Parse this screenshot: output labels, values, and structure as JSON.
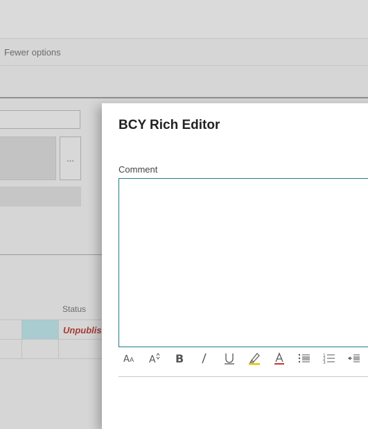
{
  "background": {
    "fewer_options": "Fewer options",
    "ellipsis": "...",
    "status_header": "Status",
    "status_value": "Unpublis"
  },
  "dialog": {
    "title": "BCY Rich Editor",
    "comment_label": "Comment",
    "toolbar": [
      "font-size-icon",
      "font-increase-icon",
      "bold-icon",
      "italic-icon",
      "underline-icon",
      "highlight-icon",
      "font-color-icon",
      "bullet-list-icon",
      "numbered-list-icon",
      "outdent-icon"
    ]
  },
  "colors": {
    "accent": "#1e7c8c",
    "status": "#a63a35",
    "highlight": "#e8c200",
    "font_color": "#c0392b"
  }
}
